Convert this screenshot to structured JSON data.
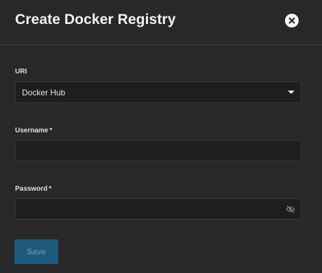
{
  "dialog": {
    "title": "Create Docker Registry",
    "close_icon": "close-circle-icon"
  },
  "form": {
    "uri": {
      "label": "URI",
      "value": "Docker Hub",
      "icon": "chevron-down-icon"
    },
    "username": {
      "label": "Username",
      "required_marker": "*",
      "value": ""
    },
    "password": {
      "label": "Password",
      "required_marker": "*",
      "value": "",
      "toggle_icon": "eye-off-icon"
    }
  },
  "actions": {
    "save_label": "Save",
    "save_disabled": true
  },
  "colors": {
    "background": "#282828",
    "field_background": "#1e1e1e",
    "save_button": "#1e5a7d",
    "save_text": "#5f8ba5"
  }
}
